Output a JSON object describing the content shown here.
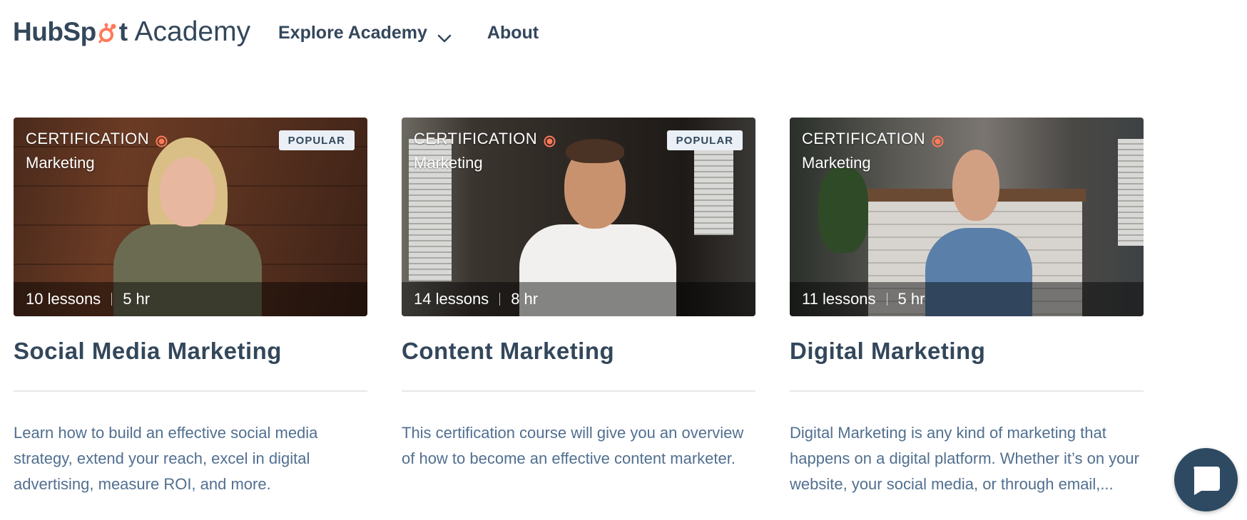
{
  "brand": {
    "logo_word": "HubSpot",
    "logo_text_left": "HubSp",
    "logo_text_right": "t",
    "product": "Academy",
    "accent_color": "#ff7a59",
    "text_color": "#33475b"
  },
  "nav": {
    "items": [
      {
        "label": "Explore Academy",
        "has_dropdown": true
      },
      {
        "label": "About",
        "has_dropdown": false
      }
    ]
  },
  "courses": [
    {
      "type_label": "CERTIFICATION",
      "topic": "Marketing",
      "badge": "POPULAR",
      "lessons": "10 lessons",
      "duration": "5 hr",
      "title": "Social Media Marketing",
      "description": "Learn how to build an effective social media strategy, extend your reach, excel in digital advertising, measure ROI, and more."
    },
    {
      "type_label": "CERTIFICATION",
      "topic": "Marketing",
      "badge": "POPULAR",
      "lessons": "14 lessons",
      "duration": "8 hr",
      "title": "Content Marketing",
      "description": "This certification course will give you an overview of how to become an effective content marketer."
    },
    {
      "type_label": "CERTIFICATION",
      "topic": "Marketing",
      "badge": "",
      "lessons": "11 lessons",
      "duration": "5 hr",
      "title": "Digital Marketing",
      "description": "Digital Marketing is any kind of marketing that happens on a digital platform. Whether it’s on your website, your social media, or through email,..."
    }
  ],
  "chat": {
    "icon": "chat-bubble-icon"
  }
}
